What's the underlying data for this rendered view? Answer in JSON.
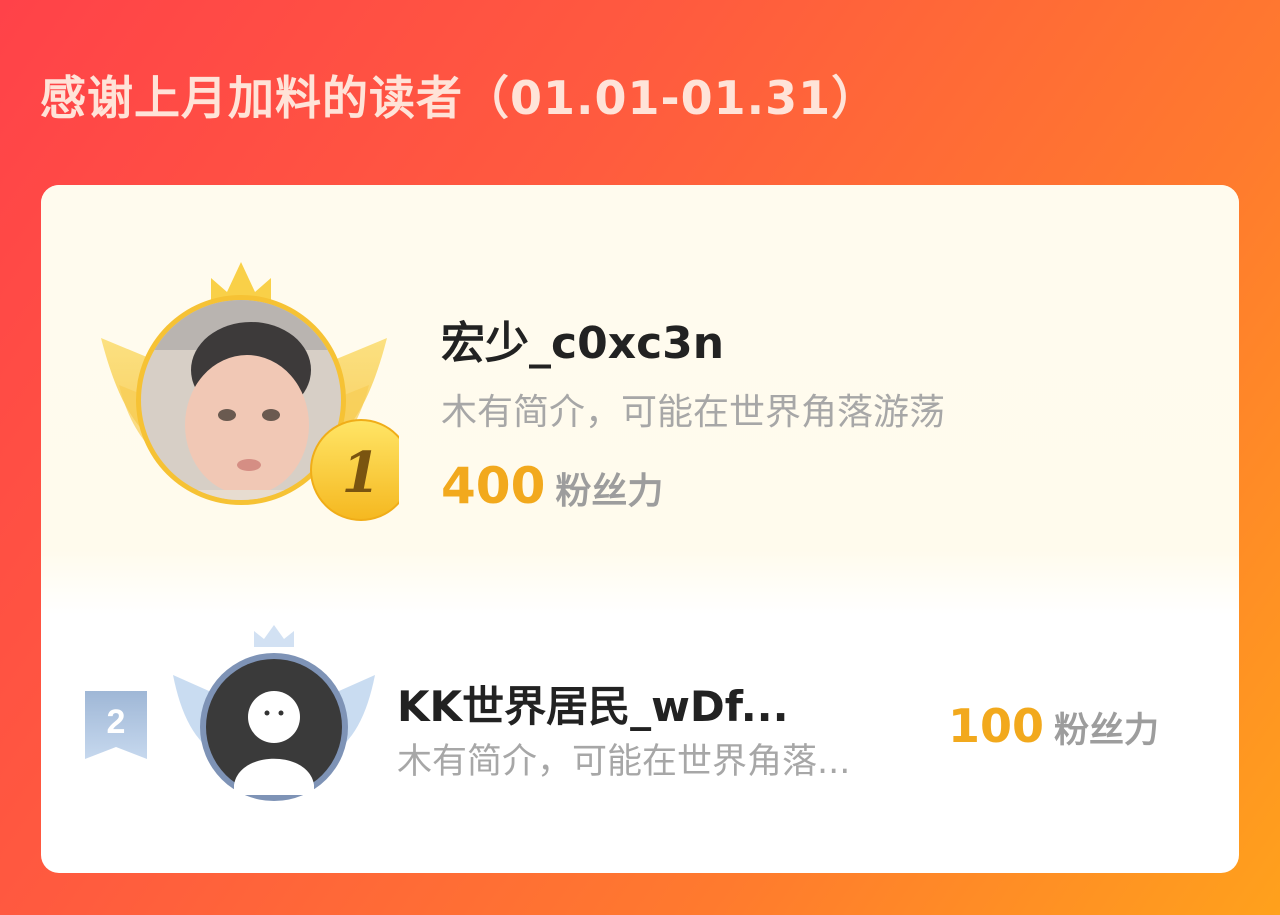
{
  "header": {
    "title": "感谢上月加料的读者（01.01-01.31）"
  },
  "readers": [
    {
      "rank": "1",
      "name": "宏少_c0xc3n",
      "bio": "木有简介，可能在世界角落游荡",
      "fans_value": "400",
      "fans_label": "粉丝力"
    },
    {
      "rank": "2",
      "name": "KK世界居民_wDf...",
      "bio": "木有简介，可能在世界角落...",
      "fans_value": "100",
      "fans_label": "粉丝力"
    }
  ],
  "colors": {
    "accent_gold": "#f2a91d",
    "wing_gold": "#f9d25b",
    "wing_silver_blue": "#bcd3ee",
    "avatar_ring_silver": "#7e93b6"
  },
  "icons": {
    "crown": "crown-icon",
    "wings": "wings-icon",
    "rank_medal": "gold-medal-icon",
    "rank_ribbon": "ribbon-bookmark-icon",
    "default_avatar": "default-avatar-icon"
  }
}
